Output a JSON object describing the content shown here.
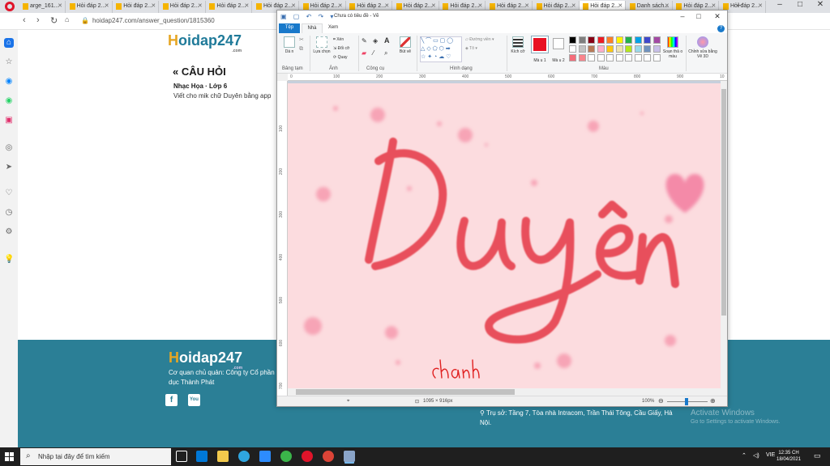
{
  "browser": {
    "tabs": [
      {
        "label": "arge_161..."
      },
      {
        "label": "Hỏi đáp 2..."
      },
      {
        "label": "Hỏi đáp 2..."
      },
      {
        "label": "Hỏi đáp 2..."
      },
      {
        "label": "Hỏi đáp 2..."
      },
      {
        "label": "Hỏi đáp 2..."
      },
      {
        "label": "Hỏi đáp 2..."
      },
      {
        "label": "Hỏi đáp 2..."
      },
      {
        "label": "Hỏi đáp 2..."
      },
      {
        "label": "Hỏi đáp 2..."
      },
      {
        "label": "Hỏi đáp 2..."
      },
      {
        "label": "Hỏi đáp 2..."
      },
      {
        "label": "Hỏi đáp 2..."
      },
      {
        "label": "Danh sách..."
      },
      {
        "label": "Hỏi đáp 2..."
      },
      {
        "label": "Hỏi đáp 2..."
      }
    ],
    "url": "hoidap247.com/answer_question/1815360"
  },
  "page": {
    "logo_h": "H",
    "logo_rest": "oidap247",
    "logo_com": ".com",
    "section_title": "« CÂU HỎI",
    "subject_grade": "Nhạc Họa · Lớp 6",
    "question_text": "Viết cho mik chữ Duyên bằng app",
    "footer_owner": "Cơ quan chủ quản: Công ty Cổ phần Giáo dục Thành Phát",
    "footer_address": "Trụ sở: Tầng 7, Tòa nhà Intracom, Trần Thái Tông, Cầu Giấy, Hà Nội."
  },
  "activation": {
    "title": "Activate Windows",
    "subtitle": "Go to Settings to activate Windows."
  },
  "paint": {
    "title": "Chưa có tiêu đề - Vẽ",
    "tabs": {
      "file": "Tệp",
      "home": "Nhà",
      "view": "Xem"
    },
    "ribbon": {
      "paste": "Dá n",
      "select": "Lựa chọn",
      "crop": "Xén",
      "resize": "Đổi cỡ",
      "rotate": "Quay",
      "brushes": "Bút vẽ",
      "outline": "Đường viền",
      "fill": "Tô",
      "size": "Kích cỡ",
      "color1": "Mà u 1",
      "color2": "Mà u 2",
      "edit_colors": "Soạn thả o màu",
      "paint3d": "Chỉnh sửa bằng Vẽ 3D"
    },
    "group_labels": {
      "clipboard": "Bảng tạm",
      "image": "Ảnh",
      "tools": "Công cụ",
      "shapes": "Hình dạng",
      "colors": "Màu"
    },
    "ruler_labels": [
      "0",
      "100",
      "200",
      "300",
      "400",
      "500",
      "600",
      "700",
      "800",
      "900",
      "10"
    ],
    "vruler_labels": [
      "100",
      "200",
      "300",
      "400",
      "500",
      "600",
      "700"
    ],
    "palette": [
      "#000000",
      "#7f7f7f",
      "#880015",
      "#ed1c24",
      "#ff7f27",
      "#fff200",
      "#22b14c",
      "#00a2e8",
      "#3f48cc",
      "#a349a4",
      "#ffffff",
      "#c3c3c3",
      "#b97a57",
      "#ffaec9",
      "#ffc90e",
      "#efe4b0",
      "#b5e61d",
      "#99d9ea",
      "#7092be",
      "#c8bfe7",
      "#f56d7a",
      "#f9858c",
      "#ffffff",
      "#ffffff",
      "#ffffff",
      "#ffffff",
      "#ffffff",
      "#ffffff",
      "#ffffff",
      "#ffffff"
    ],
    "canvas": {
      "bg": "#fcdcdf",
      "main_text": "Duyên",
      "signature": "chanh",
      "text_color": "#e8505b"
    },
    "status": {
      "canvas_size": "1095 × 916px",
      "zoom": "100%"
    }
  },
  "taskbar": {
    "search_placeholder": "Nhập tại đây để tìm kiếm",
    "lang": "VIE",
    "time": "12:35 CH",
    "date": "18/04/2021"
  }
}
